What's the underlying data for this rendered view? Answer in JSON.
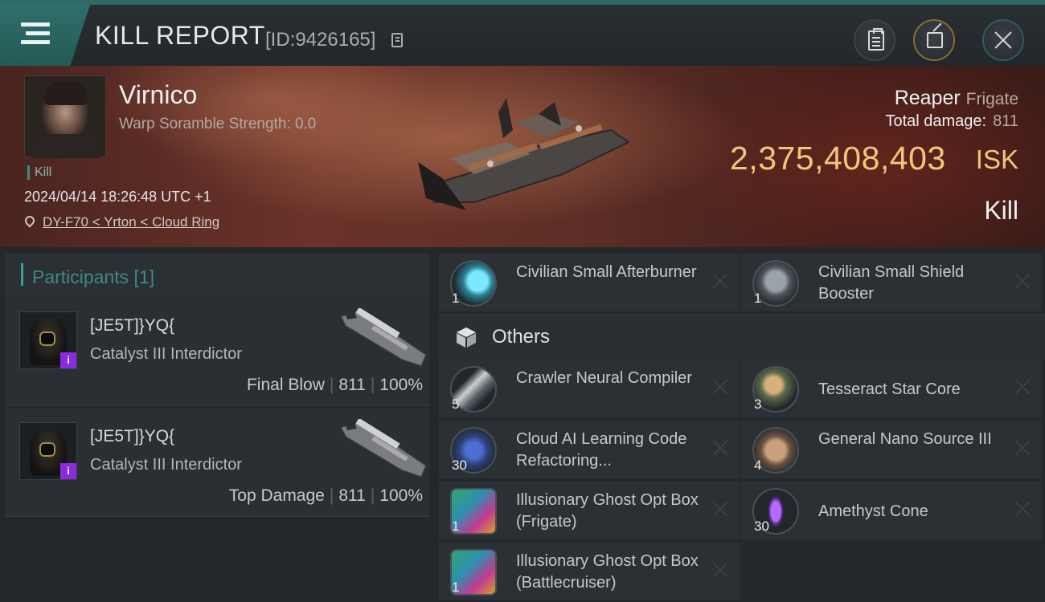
{
  "header": {
    "title": "KILL REPORT",
    "report_id": "[ID:9426165]",
    "icons": [
      "menu-icon",
      "copy-icon",
      "clipboard-icon",
      "share-icon",
      "close-icon"
    ]
  },
  "victim": {
    "name": "Virnico",
    "warp_scramble": "Warp Soramble Strength: 0.0",
    "tag": "Kill",
    "time": "2024/04/14 18:26:48 UTC +1",
    "location": "DY-F70 < Yrton < Cloud Ring",
    "ship_name": "Reaper",
    "ship_class": "Frigate",
    "total_damage_label": "Total damage:",
    "total_damage": "811",
    "isk_value": "2,375,408,403",
    "isk_unit": "ISK",
    "result": "Kill"
  },
  "participants": {
    "header": "Participants [1]",
    "rows": [
      {
        "corp": "[JE5T]}YQ{",
        "ship": "Catalyst III Interdictor",
        "role": "Final Blow",
        "damage": "811",
        "percent": "100%"
      },
      {
        "corp": "[JE5T]}YQ{",
        "ship": "Catalyst III Interdictor",
        "role": "Top Damage",
        "damage": "811",
        "percent": "100%"
      }
    ]
  },
  "items": {
    "fitted": [
      {
        "name": "Civilian Small Afterburner",
        "qty": "1",
        "icon": "afterburner-icon"
      },
      {
        "name": "Civilian Small Shield Booster",
        "qty": "1",
        "icon": "shield-booster-icon"
      }
    ],
    "others_label": "Others",
    "others": [
      {
        "name": "Crawler Neural Compiler",
        "qty": "5",
        "icon": "neural-compiler-icon"
      },
      {
        "name": "Tesseract Star Core",
        "qty": "3",
        "icon": "star-core-icon"
      },
      {
        "name": "Cloud AI Learning Code Refactoring...",
        "qty": "30",
        "icon": "ai-code-icon"
      },
      {
        "name": "General Nano Source III",
        "qty": "4",
        "icon": "nano-source-icon"
      },
      {
        "name": "Illusionary Ghost Opt Box (Frigate)",
        "qty": "1",
        "icon": "ghost-box-icon"
      },
      {
        "name": "Amethyst Cone",
        "qty": "30",
        "icon": "amethyst-icon"
      },
      {
        "name": "Illusionary Ghost Opt Box (Battlecruiser)",
        "qty": "1",
        "icon": "ghost-box-icon"
      }
    ]
  },
  "colors": {
    "accent": "#3f8a84",
    "isk": "#f0c77a",
    "hero": "#5d2e26",
    "badge": "#8a2be2"
  }
}
